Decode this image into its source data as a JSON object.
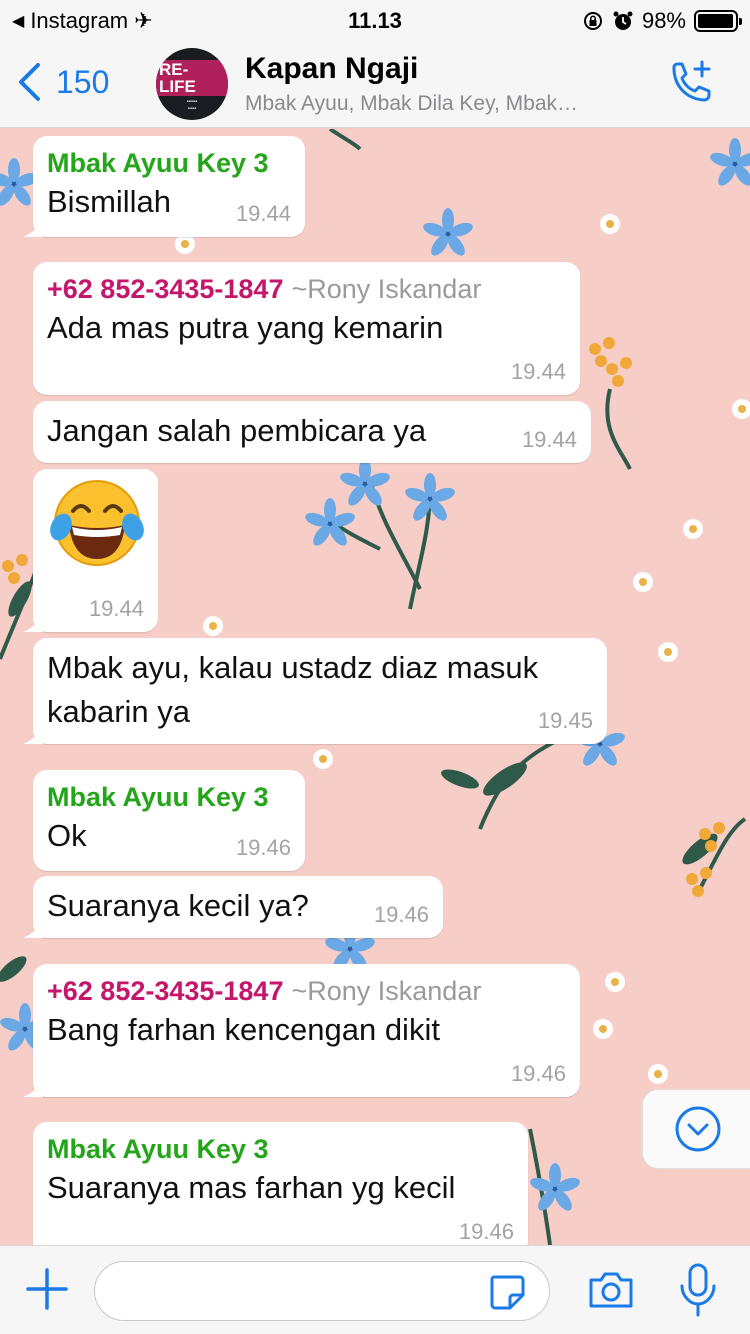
{
  "status_bar": {
    "back_app": "Instagram",
    "time": "11.13",
    "battery": "98%",
    "battery_level": 0.98
  },
  "header": {
    "back_count": "150",
    "avatar_text": "RE-LIFE",
    "title": "Kapan Ngaji",
    "subtitle": "Mbak Ayuu, Mbak Dila Key, Mbak…"
  },
  "messages": [
    {
      "sender": "Mbak Ayuu Key 3",
      "text": "Bismillah",
      "time": "19.44"
    },
    {
      "sender": "+62 852-3435-1847",
      "pushname": "~Rony Iskandar",
      "text": "Ada mas putra yang kemarin",
      "time": "19.44"
    },
    {
      "text": "Jangan salah pembicara ya",
      "time": "19.44"
    },
    {
      "text": "😂",
      "time": "19.44"
    },
    {
      "text": "Mbak ayu, kalau ustadz diaz masuk kabarin ya",
      "time": "19.45"
    },
    {
      "sender": "Mbak Ayuu Key 3",
      "text": "Ok",
      "time": "19.46"
    },
    {
      "text": "Suaranya kecil ya?",
      "time": "19.46"
    },
    {
      "sender": "+62 852-3435-1847",
      "pushname": "~Rony Iskandar",
      "text": "Bang farhan kencengan dikit",
      "time": "19.46"
    },
    {
      "sender": "Mbak Ayuu Key 3",
      "text": "Suaranya mas farhan yg kecil",
      "time": "19.46"
    }
  ],
  "composer": {
    "placeholder": ""
  },
  "colors": {
    "accent": "#1a7ae8",
    "sender_green": "#25a61a",
    "sender_pink": "#c4166b",
    "wallpaper": "#f6cec7"
  },
  "icons": [
    "back-chevron-icon",
    "airplane-icon",
    "lock-rotation-icon",
    "alarm-icon",
    "battery-icon",
    "add-call-icon",
    "chevron-down-icon",
    "plus-icon",
    "sticker-icon",
    "camera-icon",
    "mic-icon"
  ]
}
